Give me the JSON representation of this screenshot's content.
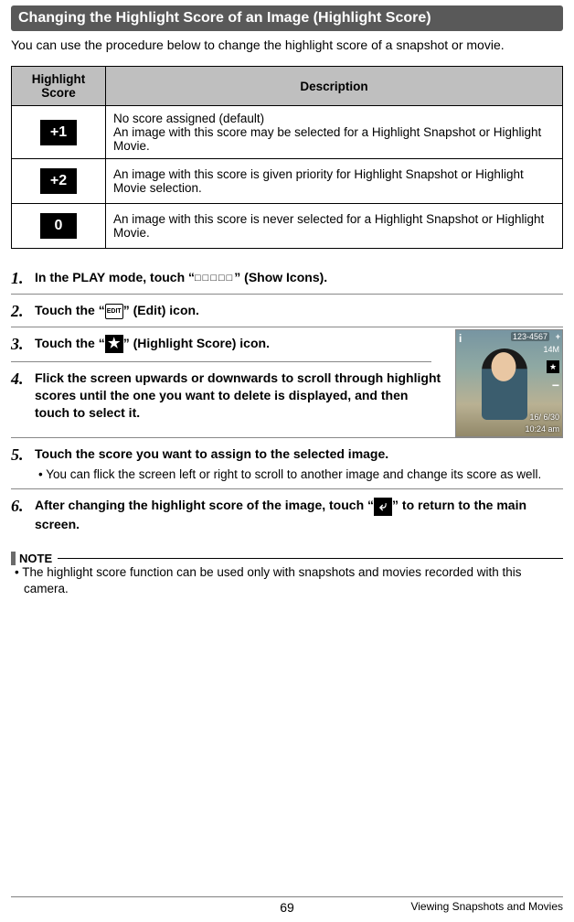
{
  "title": "Changing the Highlight Score of an Image (Highlight Score)",
  "intro": "You can use the procedure below to change the highlight score of a snapshot or movie.",
  "table": {
    "head_score": "Highlight Score",
    "head_desc": "Description",
    "rows": [
      {
        "badge": "+1",
        "desc": "No score assigned (default)\nAn image with this score may be selected for a Highlight Snapshot or Highlight Movie."
      },
      {
        "badge": "+2",
        "desc": "An image with this score is given priority for Highlight Snapshot or Highlight Movie selection."
      },
      {
        "badge": "0",
        "desc": "An image with this score is never selected for a Highlight Snapshot or Highlight Movie."
      }
    ]
  },
  "steps": {
    "s1_a": "In the PLAY mode, touch “",
    "s1_icons": "□□□□□",
    "s1_b": "” (Show Icons).",
    "s2_a": "Touch the “",
    "s2_b": "” (Edit) icon.",
    "edit_label": "EDIT",
    "s3_a": "Touch the “",
    "s3_b": "” (Highlight Score) icon.",
    "s4": "Flick the screen upwards or downwards to scroll through highlight scores until the one you want to delete is displayed, and then touch to select it.",
    "s5": "Touch the score you want to assign to the selected image.",
    "s5_sub": "• You can flick the screen left or right to scroll to another image and change its score as well.",
    "s6_a": "After changing the highlight score of the image, touch “",
    "s6_b": "” to return to the main screen."
  },
  "photo": {
    "num": "123-4567",
    "mp": "14M",
    "date": "16/  6/30",
    "time": "10:24 am"
  },
  "note": {
    "label": "NOTE",
    "body": "• The highlight score function can be used only with snapshots and movies recorded with this camera."
  },
  "footer": {
    "page": "69",
    "section": "Viewing Snapshots and Movies"
  }
}
